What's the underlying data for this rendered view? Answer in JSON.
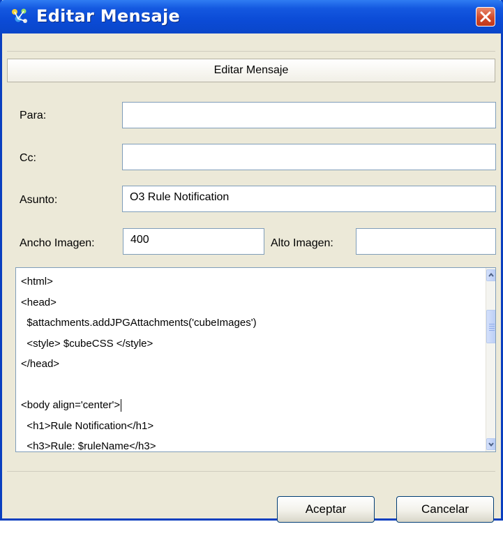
{
  "window": {
    "title": "Editar Mensaje",
    "close_icon": "close-icon",
    "app_icon": "app-icon",
    "title_color": "#0b4bd6",
    "close_color": "#d24a2a"
  },
  "header": {
    "title": "Editar Mensaje"
  },
  "form": {
    "para": {
      "label": "Para:",
      "value": ""
    },
    "cc": {
      "label": "Cc:",
      "value": ""
    },
    "asunto": {
      "label": "Asunto:",
      "value": "O3 Rule Notification"
    },
    "ancho": {
      "label": "Ancho Imagen:",
      "value": "400"
    },
    "alto": {
      "label": "Alto Imagen:",
      "value": ""
    }
  },
  "editor": {
    "lines": [
      "<html>",
      "<head>",
      "  $attachments.addJPGAttachments('cubeImages')",
      "  <style> $cubeCSS </style>",
      "</head>",
      "",
      "<body align='center'>",
      "  <h1>Rule Notification</h1>",
      "  <h3>Rule: $ruleName</h3>"
    ]
  },
  "buttons": {
    "accept": "Aceptar",
    "cancel": "Cancelar"
  }
}
